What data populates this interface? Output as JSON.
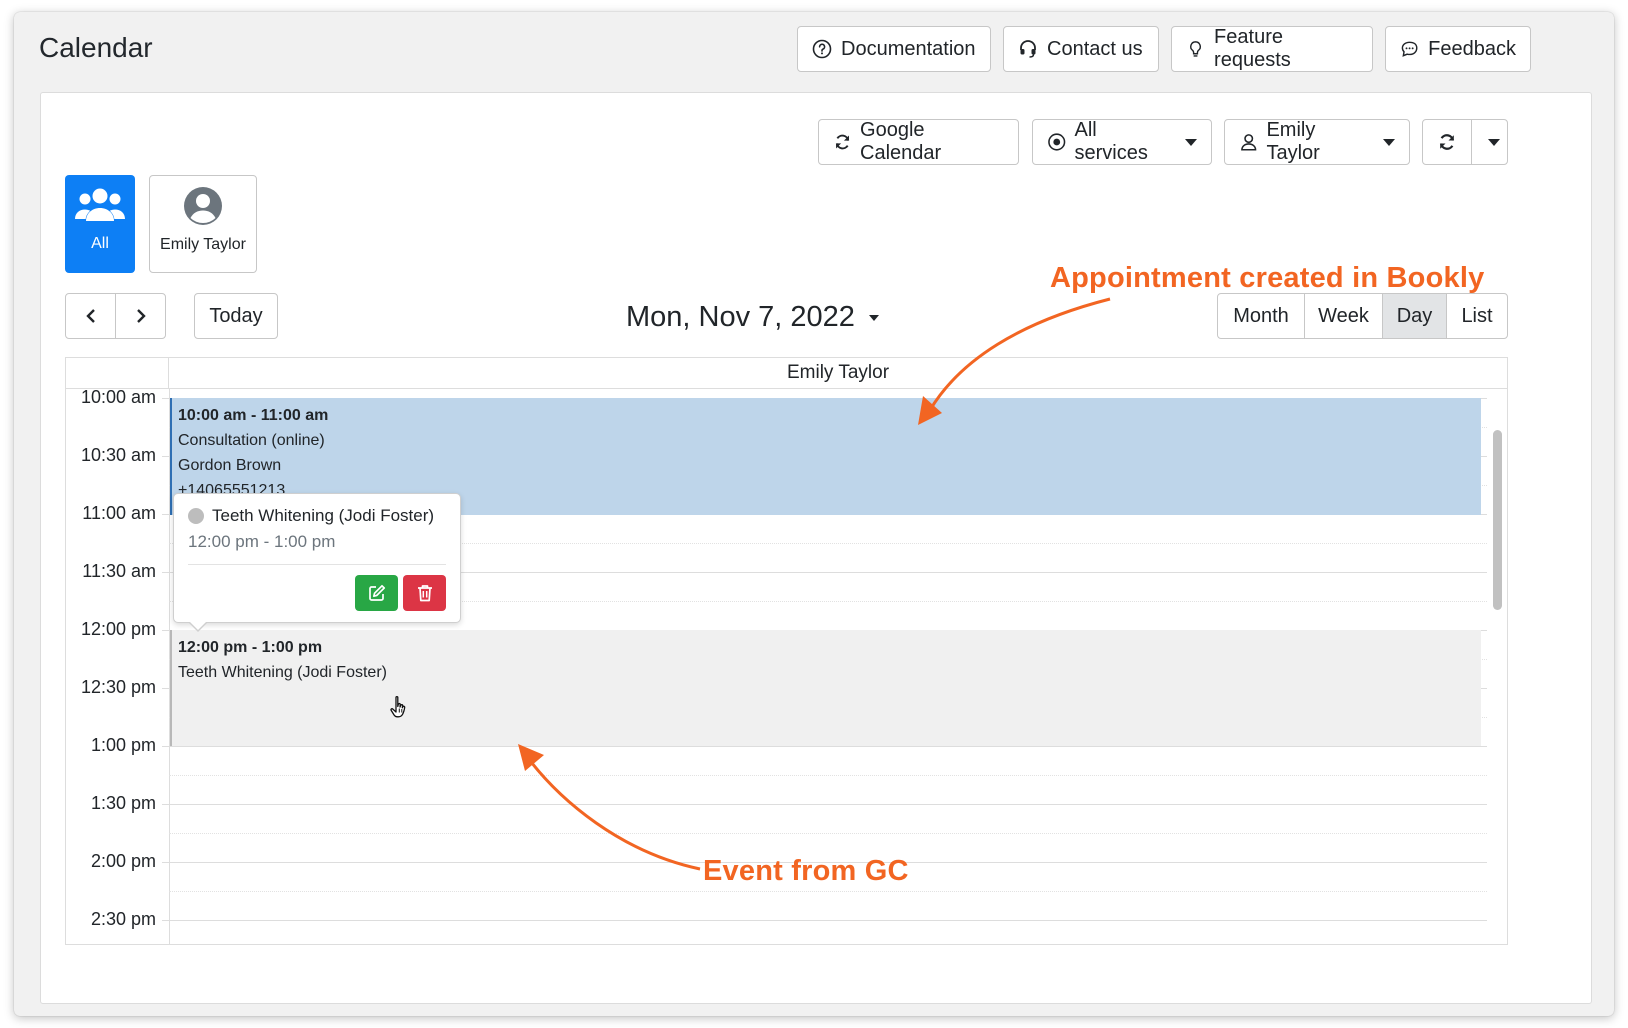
{
  "app": {
    "title": "Calendar"
  },
  "header_buttons": [
    {
      "label": "Documentation",
      "icon": "question-circle-icon"
    },
    {
      "label": "Contact us",
      "icon": "headset-icon"
    },
    {
      "label": "Feature requests",
      "icon": "lightbulb-icon"
    },
    {
      "label": "Feedback",
      "icon": "chat-icon"
    }
  ],
  "toolbar": {
    "google_calendar": "Google Calendar",
    "services": "All services",
    "staff": "Emily Taylor"
  },
  "staff_tiles": [
    {
      "label": "All",
      "icon": "users-icon",
      "active": true
    },
    {
      "label": "Emily Taylor",
      "icon": "user-circle-icon",
      "active": false
    }
  ],
  "navigation": {
    "today": "Today",
    "date": "Mon, Nov 7, 2022"
  },
  "views": [
    "Month",
    "Week",
    "Day",
    "List"
  ],
  "active_view": "Day",
  "calendar": {
    "column": "Emily Taylor",
    "times": [
      "10:00 am",
      "10:30 am",
      "11:00 am",
      "11:30 am",
      "12:00 pm",
      "12:30 pm",
      "1:00 pm",
      "1:30 pm",
      "2:00 pm",
      "2:30 pm"
    ]
  },
  "events": {
    "booked": {
      "time": "10:00 am - 11:00 am",
      "service": "Consultation (online)",
      "customer": "Gordon Brown",
      "phone": "+14065551213",
      "color": "#bed5ea"
    },
    "gc": {
      "time": "12:00 pm - 1:00 pm",
      "title": "Teeth Whitening (Jodi Foster)",
      "color": "#f0f0f0"
    }
  },
  "popover": {
    "title": "Teeth Whitening (Jodi Foster)",
    "time": "12:00 pm - 1:00 pm"
  },
  "annotations": {
    "bookly": "Appointment created in Bookly",
    "gc": "Event from GC",
    "color": "#f26522"
  }
}
